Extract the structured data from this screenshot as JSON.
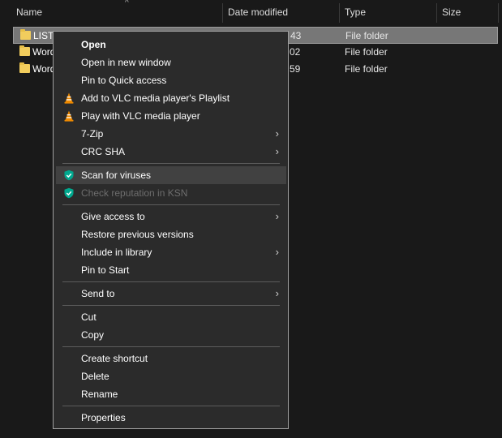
{
  "header": {
    "columns": [
      "Name",
      "Date modified",
      "Type",
      "Size"
    ],
    "sort_arrow": "^"
  },
  "files": [
    {
      "name": "LISTI",
      "date": "43",
      "type": "File folder"
    },
    {
      "name": "Word",
      "date": "02",
      "type": "File folder"
    },
    {
      "name": "Word",
      "date": "59",
      "type": "File folder"
    }
  ],
  "menu": {
    "open": "Open",
    "open_new_window": "Open in new window",
    "pin_quick_access": "Pin to Quick access",
    "vlc_playlist": "Add to VLC media player's Playlist",
    "vlc_play": "Play with VLC media player",
    "zip": "7-Zip",
    "crc": "CRC SHA",
    "scan_viruses": "Scan for viruses",
    "check_reputation": "Check reputation in KSN",
    "give_access": "Give access to",
    "restore_versions": "Restore previous versions",
    "include_library": "Include in library",
    "pin_start": "Pin to Start",
    "send_to": "Send to",
    "cut": "Cut",
    "copy": "Copy",
    "create_shortcut": "Create shortcut",
    "delete": "Delete",
    "rename": "Rename",
    "properties": "Properties",
    "submenu_arrow": "›"
  },
  "icons": {
    "folder": "folder-icon",
    "vlc": "vlc-cone-icon",
    "kaspersky": "kaspersky-shield-icon",
    "submenu": "chevron-right-icon"
  },
  "colors": {
    "background": "#191919",
    "menu_background": "#2b2b2b",
    "hover": "#414141",
    "selection": "#777777",
    "folder": "#f2cd5d",
    "vlc_orange": "#f08a00",
    "kaspersky_green": "#00a88e"
  }
}
